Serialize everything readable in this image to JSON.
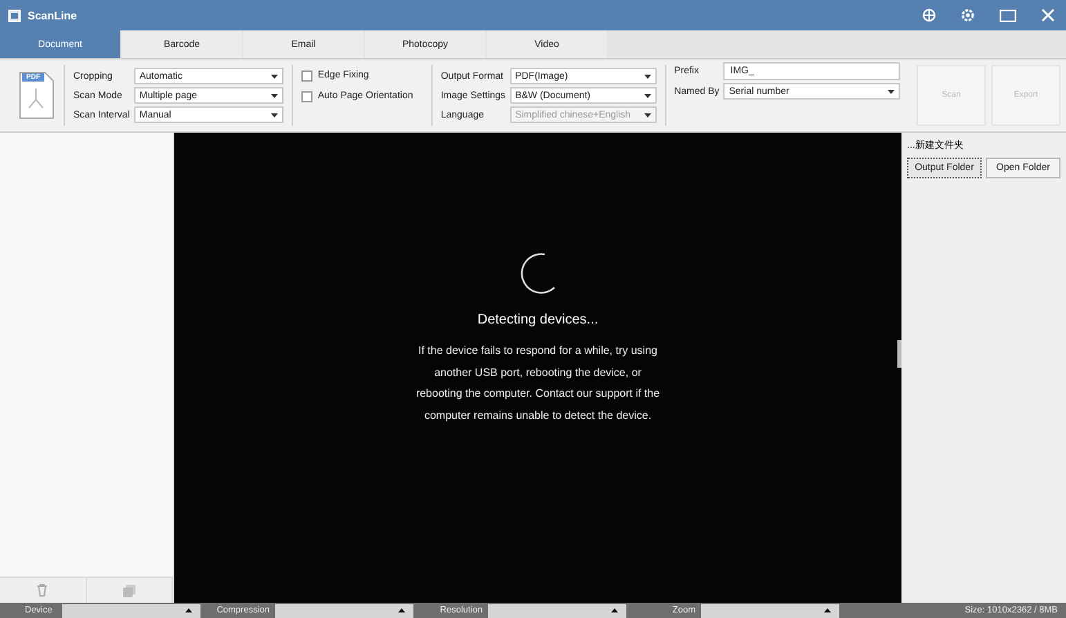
{
  "window": {
    "title": "ScanLine"
  },
  "tabs": [
    {
      "label": "Document",
      "selected": true
    },
    {
      "label": "Barcode",
      "selected": false
    },
    {
      "label": "Email",
      "selected": false
    },
    {
      "label": "Photocopy",
      "selected": false
    },
    {
      "label": "Video",
      "selected": false
    }
  ],
  "toolbar": {
    "file_icon_label": "PDF",
    "scan_settings": [
      {
        "label": "Cropping",
        "value": "Automatic"
      },
      {
        "label": "Scan Mode",
        "value": "Multiple page"
      },
      {
        "label": "Scan Interval",
        "value": "Manual"
      }
    ],
    "options": [
      {
        "label": "Edge Fixing",
        "checked": false
      },
      {
        "label": "Auto Page Orientation",
        "checked": false
      }
    ],
    "output_settings": [
      {
        "label": "Output Format",
        "value": "PDF(Image)",
        "disabled": false
      },
      {
        "label": "Image Settings",
        "value": "B&W (Document)",
        "disabled": false
      },
      {
        "label": "Language",
        "value": "Simplified chinese+English",
        "disabled": true
      }
    ],
    "prefix": {
      "label": "Prefix",
      "value": "IMG_"
    },
    "named_by": {
      "label": "Named By",
      "value": "Serial number"
    },
    "actions": [
      {
        "label": "Scan",
        "disabled": true
      },
      {
        "label": "Export",
        "disabled": true
      }
    ]
  },
  "preview": {
    "status": "Detecting devices...",
    "message": "If the device fails to respond for a while, try using another USB port, rebooting the device, or rebooting the computer. Contact our support if the computer remains unable to detect the device."
  },
  "output_panel": {
    "folder": "...新建文件夹",
    "buttons": [
      {
        "label": "Output Folder",
        "selected": true
      },
      {
        "label": "Open Folder",
        "selected": false
      }
    ]
  },
  "status_bar": {
    "fields": [
      "Device",
      "Compression",
      "Resolution",
      "Zoom"
    ],
    "size": "Size: 1010x2362 / 8MB"
  }
}
